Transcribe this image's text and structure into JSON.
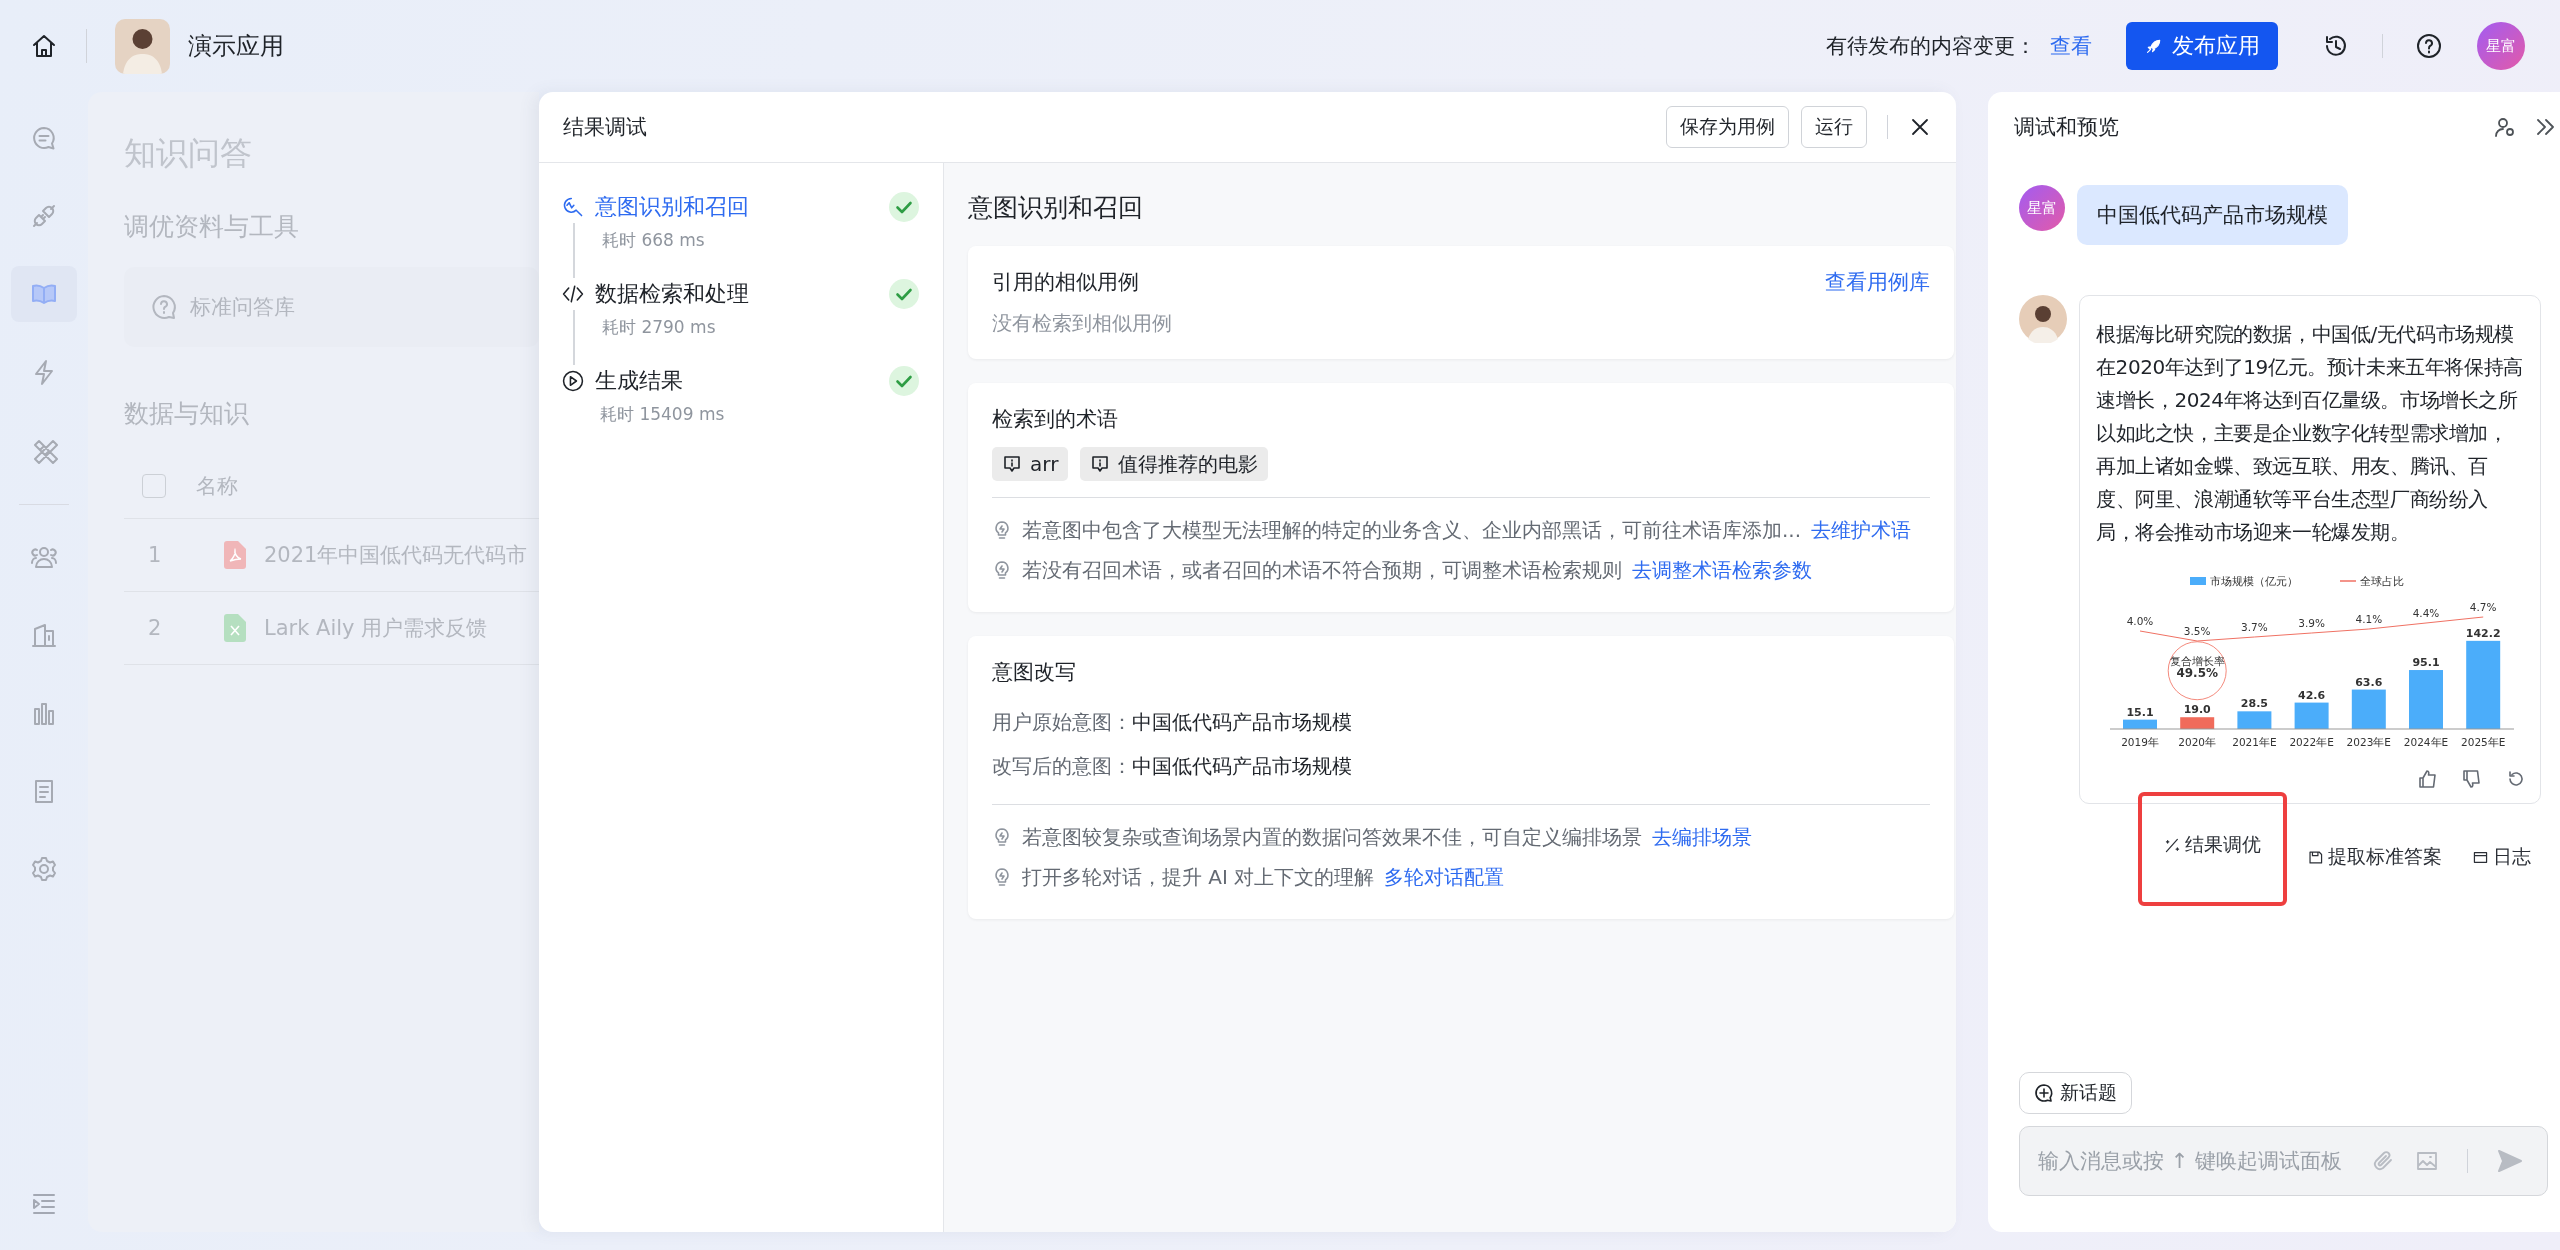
{
  "topbar": {
    "app_name": "演示应用",
    "pending_label": "有待发布的内容变更：",
    "view_link": "查看",
    "publish_button": "发布应用",
    "user_avatar": "星富"
  },
  "nav_rail": {
    "groups": [
      {
        "items": [
          {
            "kind": "chat",
            "selected": false
          },
          {
            "kind": "plug",
            "selected": false
          },
          {
            "kind": "book",
            "selected": true
          },
          {
            "kind": "lightning",
            "selected": false
          },
          {
            "kind": "tools",
            "selected": false
          }
        ]
      },
      {
        "items": [
          {
            "kind": "people",
            "selected": false
          },
          {
            "kind": "building",
            "selected": false
          },
          {
            "kind": "bars",
            "selected": false
          },
          {
            "kind": "document",
            "selected": false
          },
          {
            "kind": "gear",
            "selected": false
          }
        ]
      }
    ]
  },
  "knowledge_page": {
    "title": "知识问答",
    "tools_heading": "调优资料与工具",
    "tool_card": "标准问答库",
    "data_heading": "数据与知识",
    "table": {
      "select_all_checked": false,
      "columns": [
        "名称"
      ],
      "rows": [
        {
          "index": "1",
          "kind": "pdf",
          "name": "2021年中国低代码无代码市"
        },
        {
          "index": "2",
          "kind": "sheet",
          "name": "Lark Aily 用户需求反馈"
        }
      ]
    }
  },
  "debug_dialog": {
    "title": "结果调试",
    "buttons": [
      "保存为用例",
      "运行"
    ],
    "steps": [
      {
        "kind": "intent",
        "label": "意图识别和召回",
        "duration": "耗时 668 ms",
        "selected": true,
        "done": true
      },
      {
        "kind": "code",
        "label": "数据检索和处理",
        "duration": "耗时 2790 ms",
        "selected": false,
        "done": true
      },
      {
        "kind": "generate",
        "label": "生成结果",
        "duration": "耗时 15409 ms",
        "selected": false,
        "done": true
      }
    ],
    "section_title": "意图识别和召回",
    "cards": [
      {
        "kind": "cases",
        "title": "引用的相似用例",
        "link": "查看用例库",
        "empty_text": "没有检索到相似用例"
      },
      {
        "kind": "terms",
        "title": "检索到的术语",
        "tags": [
          "arr",
          "值得推荐的电影"
        ],
        "tips": [
          {
            "text": "若意图中包含了大模型无法理解的特定的业务含义、企业内部黑话，可前往术语库添加...",
            "link": "去维护术语"
          },
          {
            "text": "若没有召回术语，或者召回的术语不符合预期，可调整术语检索规则",
            "link": "去调整术语检索参数"
          }
        ]
      },
      {
        "kind": "rewrite",
        "title": "意图改写",
        "fields": [
          {
            "label": "用户原始意图：",
            "value": "中国低代码产品市场规模"
          },
          {
            "label": "改写后的意图：",
            "value": "中国低代码产品市场规模"
          }
        ],
        "tips": [
          {
            "text": "若意图较复杂或查询场景内置的数据问答效果不佳，可自定义编排场景",
            "link": "去编排场景"
          },
          {
            "text": "打开多轮对话，提升 AI 对上下文的理解",
            "link": "多轮对话配置"
          }
        ]
      }
    ]
  },
  "preview_panel": {
    "title": "调试和预览",
    "user_message": {
      "avatar": "星富",
      "text": "中国低代码产品市场规模"
    },
    "bot_message": {
      "text": "根据海比研究院的数据，中国低/无代码市场规模在2020年达到了19亿元。预计未来五年将保持高速增长，2024年将达到百亿量级。市场增长之所以如此之快，主要是企业数字化转型需求增加，再加上诸如金蝶、致远互联、用友、腾讯、百度、阿里、浪潮通软等平台生态型厂商纷纷入局，将会推动市场迎来一轮爆发期。",
      "chart_data": {
        "type": "bar",
        "categories": [
          "2019年",
          "2020年",
          "2021年E",
          "2022年E",
          "2023年E",
          "2024年E",
          "2025年E"
        ],
        "series": [
          {
            "name": "市场规模（亿元）",
            "color": "#4badfa",
            "colors": [
              "#4badfa",
              "#f06b5b",
              "#4badfa",
              "#4badfa",
              "#4badfa",
              "#4badfa",
              "#4badfa"
            ],
            "values": [
              15.1,
              19.0,
              28.5,
              42.6,
              63.6,
              95.1,
              142.2
            ],
            "value_labels": [
              "15.1",
              "19.0",
              "28.5",
              "42.6",
              "63.6",
              "95.1",
              "142.2"
            ]
          },
          {
            "name": "全球占比",
            "color": "#f07163",
            "type": "line",
            "axis": "y2",
            "values": [
              4.0,
              3.5,
              3.7,
              3.9,
              4.1,
              4.4,
              4.7
            ],
            "value_labels": [
              "4.0%",
              "3.5%",
              "3.7%",
              "3.9%",
              "4.1%",
              "4.4%",
              "4.7%"
            ]
          }
        ],
        "data_labels": true,
        "legend": "top",
        "annotations": [
          "复合增长率",
          "49.5%"
        ]
      }
    },
    "actions": [
      {
        "kind": "tune",
        "label": "结果调优",
        "highlighted": true
      },
      {
        "kind": "save",
        "label": "提取标准答案",
        "highlighted": false
      },
      {
        "kind": "log",
        "label": "日志",
        "highlighted": false
      }
    ],
    "new_topic_button": "新话题",
    "input": {
      "placeholder": "输入消息或按 ↑ 键唤起调试面板"
    }
  }
}
